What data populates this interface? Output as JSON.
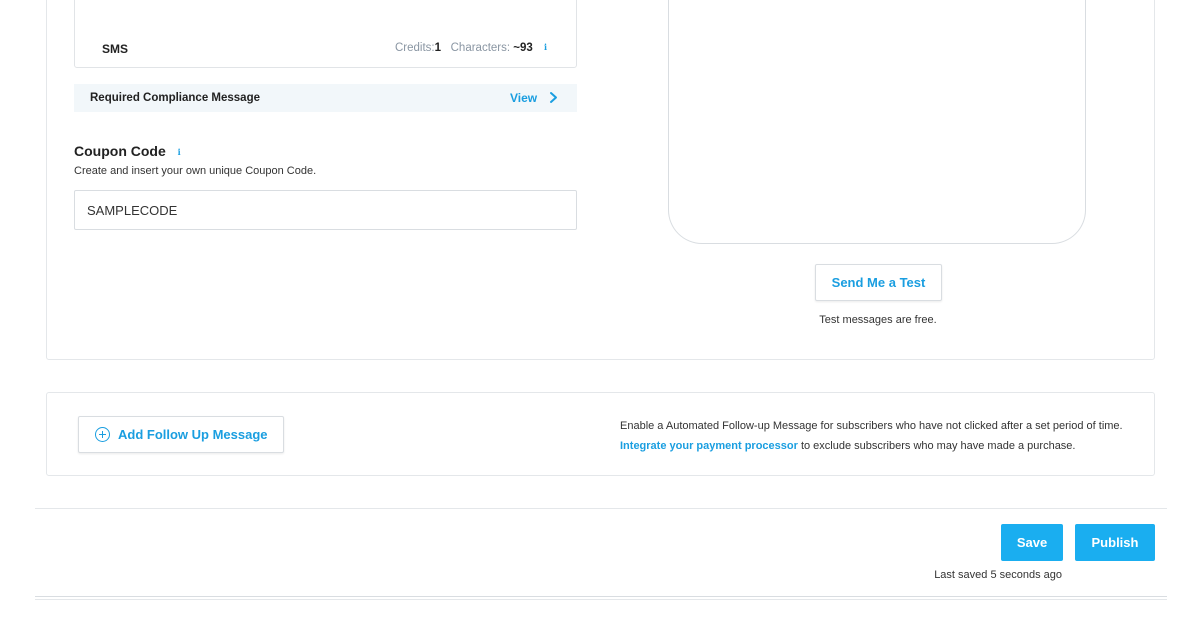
{
  "sms": {
    "label": "SMS",
    "credits_label": "Credits:",
    "credits_value": "1",
    "characters_label": "Characters:",
    "characters_value": "~93"
  },
  "compliance": {
    "label": "Required Compliance Message",
    "view_label": "View"
  },
  "coupon": {
    "title": "Coupon Code",
    "description": "Create and insert your own unique Coupon Code.",
    "value": "SAMPLECODE"
  },
  "test": {
    "button_label": "Send Me a Test",
    "note": "Test messages are free."
  },
  "follow_up": {
    "button_label": "Add Follow Up Message",
    "text_before": "Enable a Automated Follow-up Message for subscribers who have not clicked after a set period of time.",
    "link_label": "Integrate your payment processor",
    "text_after": "to exclude subscribers who may have made a purchase."
  },
  "footer": {
    "save_label": "Save",
    "publish_label": "Publish",
    "last_saved": "Last saved 5 seconds ago"
  },
  "colors": {
    "accent": "#1a9ee0",
    "button_fill": "#1aaef0"
  }
}
